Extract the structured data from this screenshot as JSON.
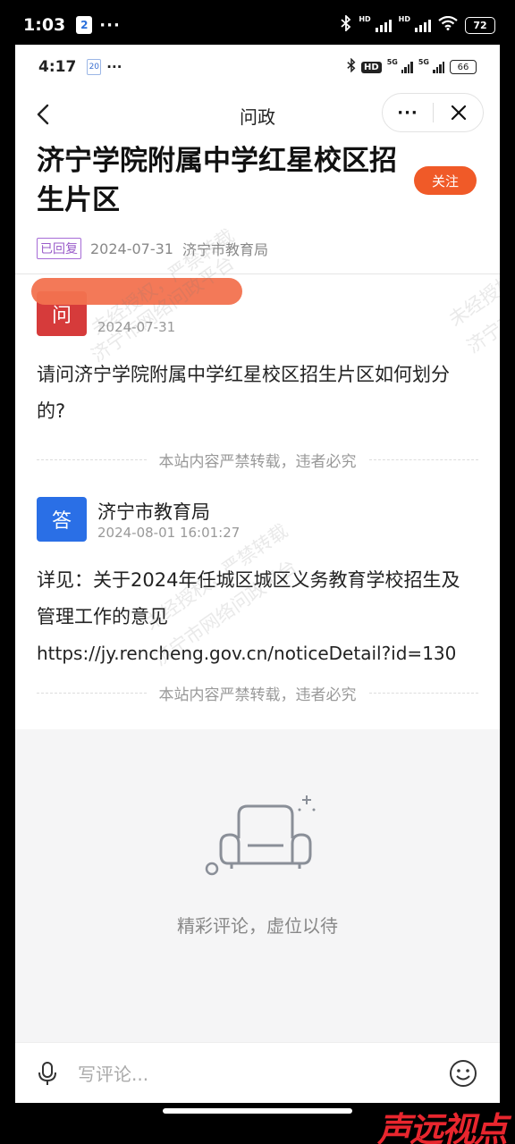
{
  "outer_status": {
    "time": "1:03",
    "app_badge": "2",
    "more": "···",
    "battery": "72"
  },
  "inner_status": {
    "time": "4:17",
    "badge": "20",
    "more": "···",
    "hd": "HD",
    "net1": "5G",
    "net2": "5G",
    "battery": "66"
  },
  "nav": {
    "title": "问政",
    "more_label": "···"
  },
  "article": {
    "title": "济宁学院附属中学红星校区招生片区",
    "follow_label": "关注",
    "status_tag": "已回复",
    "date": "2024-07-31",
    "org": "济宁市教育局"
  },
  "question": {
    "badge": "问",
    "asker": "",
    "time": "2024-07-31",
    "content": "请问济宁学院附属中学红星校区招生片区如何划分的?",
    "notice": "本站内容严禁转载，违者必究"
  },
  "answer": {
    "badge": "答",
    "responder": "济宁市教育局",
    "time": "2024-08-01 16:01:27",
    "content": "详见：关于2024年任城区城区义务教育学校招生及管理工作的意见",
    "url": "https://jy.rencheng.gov.cn/noticeDetail?id=130",
    "notice": "本站内容严禁转载，违者必究"
  },
  "comments": {
    "empty_text": "精彩评论，虚位以待"
  },
  "comment_bar": {
    "placeholder": "写评论..."
  },
  "watermarks": [
    "未经授权，严禁转载",
    "济宁市网络问政平台"
  ],
  "logo_text": "声远视点",
  "colors": {
    "follow": "#f05a28",
    "ask_badge": "#d63b3b",
    "answer_badge": "#2a6fe6",
    "tag": "#9a5cc9"
  }
}
